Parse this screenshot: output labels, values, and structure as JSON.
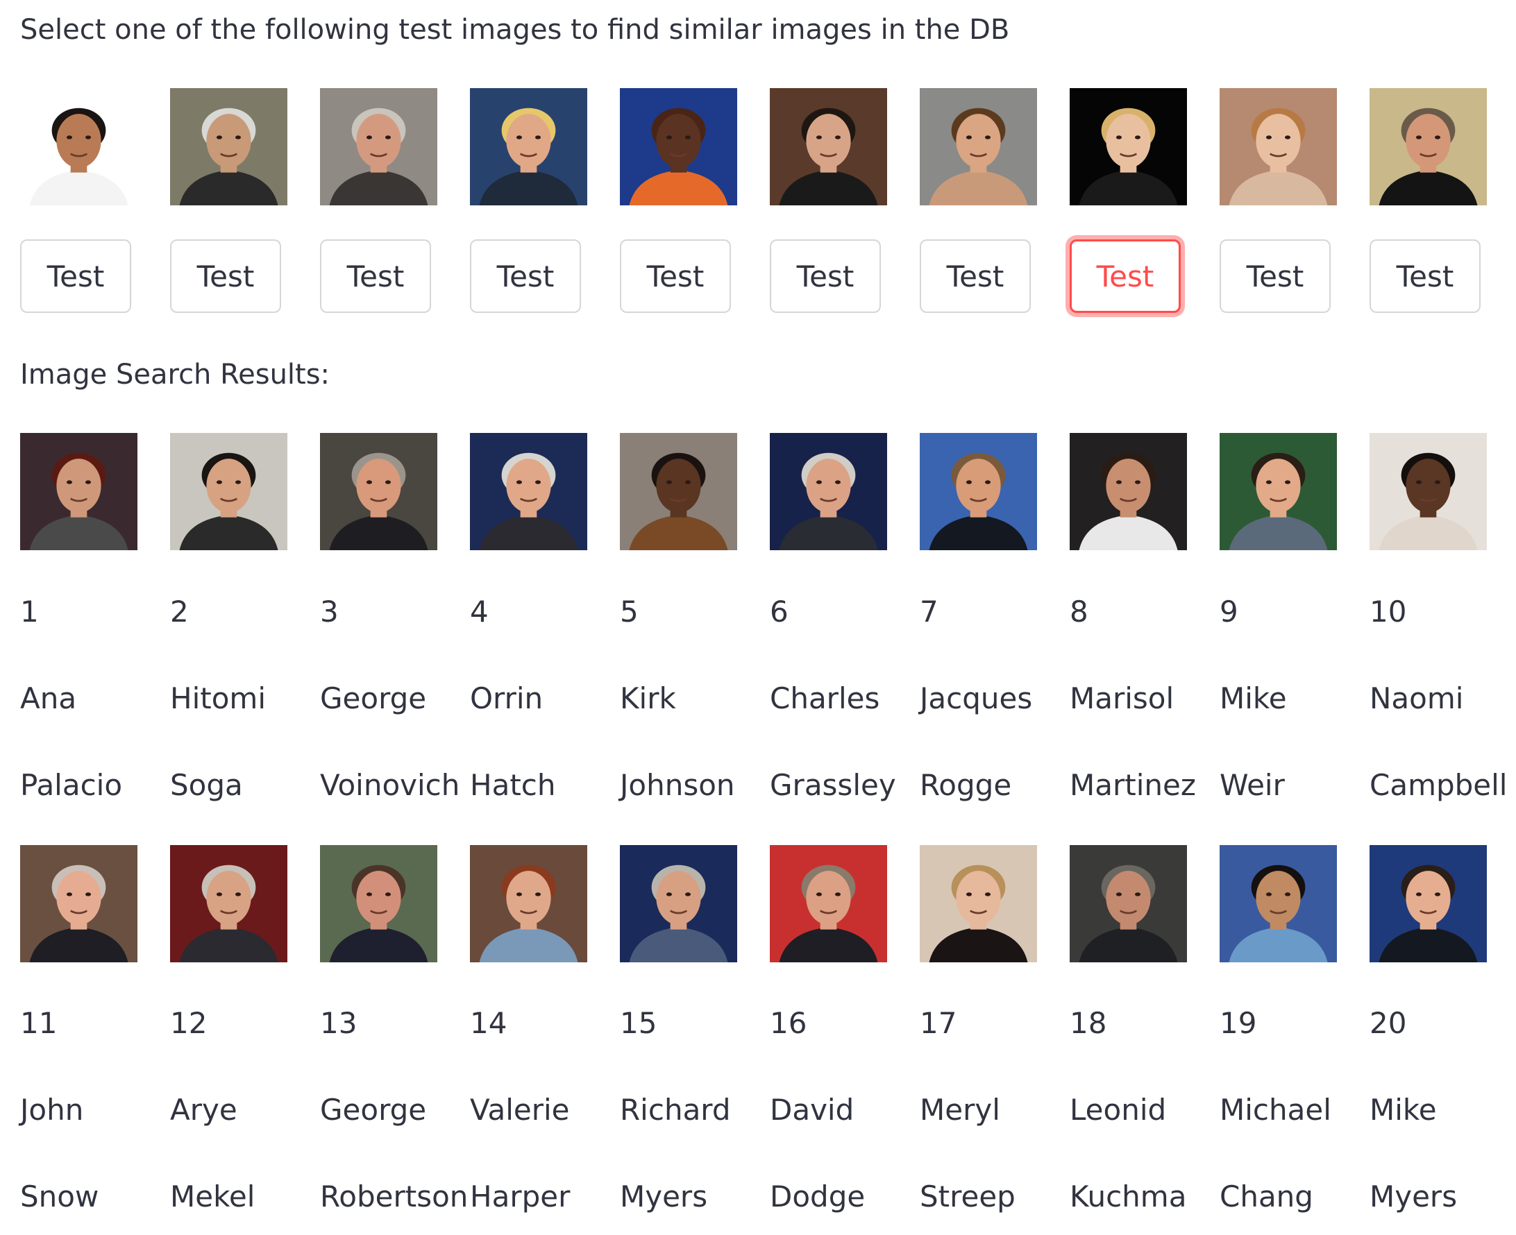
{
  "prompt": "Select one of the following test images to find similar images in the DB",
  "results_title": "Image Search Results:",
  "test_button_label": "Test",
  "selected_test_index": 7,
  "colors": {
    "text": "#31333f",
    "button_border": "#d6d6d9",
    "accent": "#ff4b4b"
  },
  "test_images": [
    {
      "icon": "face-photo",
      "bg": "#ffffff",
      "skin": "#b97b55",
      "hair": "#1a1412",
      "shirt": "#f4f4f4"
    },
    {
      "icon": "face-photo",
      "bg": "#7d7a68",
      "skin": "#c89a78",
      "hair": "#d8d8d4",
      "shirt": "#2a2a2a"
    },
    {
      "icon": "face-photo",
      "bg": "#8f8a84",
      "skin": "#d49a80",
      "hair": "#c9c4bc",
      "shirt": "#3a3633"
    },
    {
      "icon": "face-photo",
      "bg": "#28426e",
      "skin": "#e0a886",
      "hair": "#e6c76a",
      "shirt": "#1f2a3a"
    },
    {
      "icon": "face-photo",
      "bg": "#1e3a8a",
      "skin": "#5a3322",
      "hair": "#4a2414",
      "shirt": "#e56a2a"
    },
    {
      "icon": "face-photo",
      "bg": "#5a3a2a",
      "skin": "#d8a488",
      "hair": "#1e1612",
      "shirt": "#1a1a1a"
    },
    {
      "icon": "face-photo",
      "bg": "#8a8a88",
      "skin": "#d9a582",
      "hair": "#5c3a1e",
      "shirt": "#c89a7a"
    },
    {
      "icon": "face-photo",
      "bg": "#050505",
      "skin": "#e8c0a0",
      "hair": "#d8b26a",
      "shirt": "#1a1a1a"
    },
    {
      "icon": "face-photo",
      "bg": "#b58a70",
      "skin": "#e9bfa2",
      "hair": "#b87a44",
      "shirt": "#d8b89e"
    },
    {
      "icon": "face-photo",
      "bg": "#c9b88a",
      "skin": "#d49878",
      "hair": "#6a5a4a",
      "shirt": "#141414"
    }
  ],
  "results": [
    {
      "rank": "1",
      "first": "Ana",
      "last": "Palacio",
      "icon": "face-photo",
      "bg": "#3a2a30",
      "skin": "#d0987a",
      "hair": "#5a1a12",
      "shirt": "#4a4a4a"
    },
    {
      "rank": "2",
      "first": "Hitomi",
      "last": "Soga",
      "icon": "face-photo",
      "bg": "#c8c6be",
      "skin": "#d6a282",
      "hair": "#1a1412",
      "shirt": "#2a2a2a"
    },
    {
      "rank": "3",
      "first": "George",
      "last": "Voinovich",
      "icon": "face-photo",
      "bg": "#4a4640",
      "skin": "#d89a7a",
      "hair": "#9a948c",
      "shirt": "#1e1e22"
    },
    {
      "rank": "4",
      "first": "Orrin",
      "last": "Hatch",
      "icon": "face-photo",
      "bg": "#1c2a56",
      "skin": "#e0a888",
      "hair": "#d6d4d0",
      "shirt": "#2a2a30"
    },
    {
      "rank": "5",
      "first": "Kirk",
      "last": "Johnson",
      "icon": "face-photo",
      "bg": "#8a8078",
      "skin": "#5a3522",
      "hair": "#1a1210",
      "shirt": "#7a4a26"
    },
    {
      "rank": "6",
      "first": "Charles",
      "last": "Grassley",
      "icon": "face-photo",
      "bg": "#16224a",
      "skin": "#dca286",
      "hair": "#d0ccc6",
      "shirt": "#2a2c34"
    },
    {
      "rank": "7",
      "first": "Jacques",
      "last": "Rogge",
      "icon": "face-photo",
      "bg": "#3a64b0",
      "skin": "#d89c78",
      "hair": "#7a5a3a",
      "shirt": "#141820"
    },
    {
      "rank": "8",
      "first": "Marisol",
      "last": "Martinez",
      "icon": "face-photo",
      "bg": "#222020",
      "skin": "#c88e70",
      "hair": "#2a1c14",
      "shirt": "#e8e8e8"
    },
    {
      "rank": "9",
      "first": "Mike",
      "last": "Weir",
      "icon": "face-photo",
      "bg": "#2c5a34",
      "skin": "#e2aa88",
      "hair": "#2a1e16",
      "shirt": "#5a6a7a"
    },
    {
      "rank": "10",
      "first": "Naomi",
      "last": "Campbell",
      "icon": "face-photo",
      "bg": "#e6e0da",
      "skin": "#5a3624",
      "hair": "#140e0c",
      "shirt": "#e0d6cc"
    },
    {
      "rank": "11",
      "first": "John",
      "last": "Snow",
      "icon": "face-photo",
      "bg": "#6a5040",
      "skin": "#e6ac92",
      "hair": "#c8c0b8",
      "shirt": "#1e1e24"
    },
    {
      "rank": "12",
      "first": "Arye",
      "last": "Mekel",
      "icon": "face-photo",
      "bg": "#6a1a1a",
      "skin": "#d8a284",
      "hair": "#c6c0b8",
      "shirt": "#2a2a30"
    },
    {
      "rank": "13",
      "first": "George",
      "last": "Robertson",
      "icon": "face-photo",
      "bg": "#5a6a50",
      "skin": "#d2907a",
      "hair": "#4a3428",
      "shirt": "#1e2030"
    },
    {
      "rank": "14",
      "first": "Valerie",
      "last": "Harper",
      "icon": "face-photo",
      "bg": "#6a4a3a",
      "skin": "#e0a88a",
      "hair": "#8a3a1e",
      "shirt": "#7a98b8"
    },
    {
      "rank": "15",
      "first": "Richard",
      "last": "Myers",
      "icon": "face-photo",
      "bg": "#1a2a5a",
      "skin": "#d8a082",
      "hair": "#b8b4ac",
      "shirt": "#4a5a7a"
    },
    {
      "rank": "16",
      "first": "David",
      "last": "Dodge",
      "icon": "face-photo",
      "bg": "#c83030",
      "skin": "#dca084",
      "hair": "#8a7a6a",
      "shirt": "#1e1e24"
    },
    {
      "rank": "17",
      "first": "Meryl",
      "last": "Streep",
      "icon": "face-photo",
      "bg": "#d8c6b4",
      "skin": "#e6b89c",
      "hair": "#b8905a",
      "shirt": "#1a1414"
    },
    {
      "rank": "18",
      "first": "Leonid",
      "last": "Kuchma",
      "icon": "face-photo",
      "bg": "#3a3a38",
      "skin": "#c48a70",
      "hair": "#6a6660",
      "shirt": "#1e2024"
    },
    {
      "rank": "19",
      "first": "Michael",
      "last": "Chang",
      "icon": "face-photo",
      "bg": "#3a5aa0",
      "skin": "#c08a62",
      "hair": "#141010",
      "shirt": "#6a9ac8"
    },
    {
      "rank": "20",
      "first": "Mike",
      "last": "Myers",
      "icon": "face-photo",
      "bg": "#1e3a7a",
      "skin": "#e6ae90",
      "hair": "#2a1e18",
      "shirt": "#141820"
    }
  ]
}
